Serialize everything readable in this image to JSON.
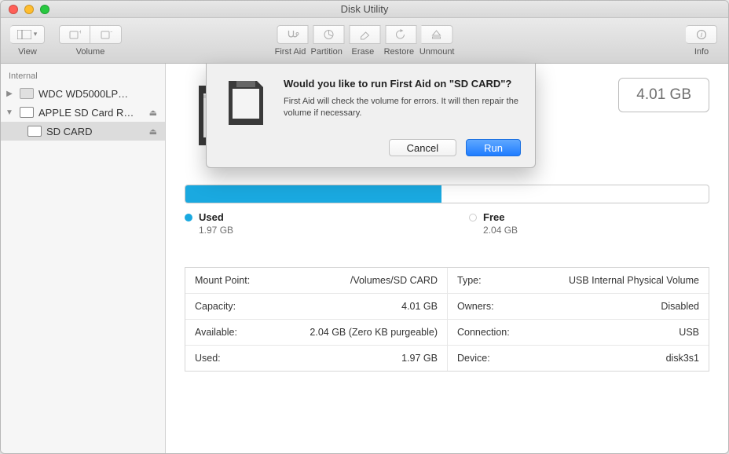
{
  "window": {
    "title": "Disk Utility"
  },
  "toolbar": {
    "view_label": "View",
    "volume_label": "Volume",
    "info_label": "Info",
    "center": {
      "first_aid": "First Aid",
      "partition": "Partition",
      "erase": "Erase",
      "restore": "Restore",
      "unmount": "Unmount"
    }
  },
  "sidebar": {
    "section": "Internal",
    "items": [
      {
        "label": "WDC WD5000LP…"
      },
      {
        "label": "APPLE SD Card R…"
      },
      {
        "label": "SD CARD"
      }
    ]
  },
  "main": {
    "size_pill": "4.01 GB",
    "usage_percent": 49,
    "legend": {
      "used_label": "Used",
      "used_value": "1.97 GB",
      "free_label": "Free",
      "free_value": "2.04 GB"
    },
    "details": {
      "mount_point_k": "Mount Point:",
      "mount_point_v": "/Volumes/SD CARD",
      "capacity_k": "Capacity:",
      "capacity_v": "4.01 GB",
      "available_k": "Available:",
      "available_v": "2.04 GB (Zero KB purgeable)",
      "used_k": "Used:",
      "used_v": "1.97 GB",
      "type_k": "Type:",
      "type_v": "USB Internal Physical Volume",
      "owners_k": "Owners:",
      "owners_v": "Disabled",
      "connection_k": "Connection:",
      "connection_v": "USB",
      "device_k": "Device:",
      "device_v": "disk3s1"
    }
  },
  "dialog": {
    "heading": "Would you like to run First Aid on \"SD CARD\"?",
    "body": "First Aid will check the volume for errors. It will then repair the volume if necessary.",
    "cancel": "Cancel",
    "run": "Run"
  },
  "colors": {
    "used": "#1aa9e0",
    "free": "#ffffff"
  }
}
